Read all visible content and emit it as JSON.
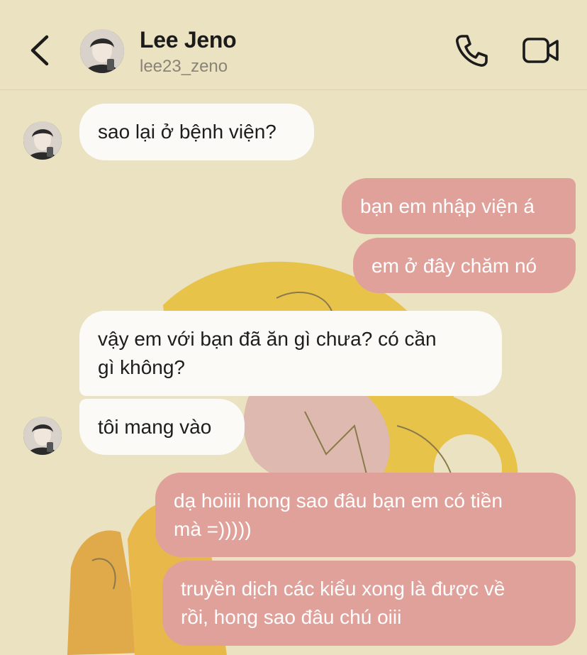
{
  "header": {
    "contact_name": "Lee Jeno",
    "username": "lee23_zeno",
    "icons": [
      "back-icon",
      "phone-icon",
      "video-camera-icon"
    ]
  },
  "colors": {
    "background": "#ebe2c2",
    "incoming_bubble": "#fbfaf7",
    "outgoing_bubble": "#e0a19a",
    "art_yellow": "#e8c34a",
    "art_pink": "#ddb9b0"
  },
  "messages": [
    {
      "direction": "incoming",
      "text": "sao lại ở bệnh viện?"
    },
    {
      "direction": "outgoing",
      "text": "bạn em nhập viện á"
    },
    {
      "direction": "outgoing",
      "text": "em ở đây chăm nó"
    },
    {
      "direction": "incoming",
      "text": "vậy em với bạn đã ăn gì chưa? có cần\ngì không?"
    },
    {
      "direction": "incoming",
      "text": "tôi mang vào"
    },
    {
      "direction": "outgoing",
      "text": "dạ hoiiii hong sao đâu bạn em có tiền\nmà =)))))"
    },
    {
      "direction": "outgoing",
      "text": "truyền dịch các kiểu xong là được về\nrồi, hong sao đâu chú oiii"
    }
  ]
}
